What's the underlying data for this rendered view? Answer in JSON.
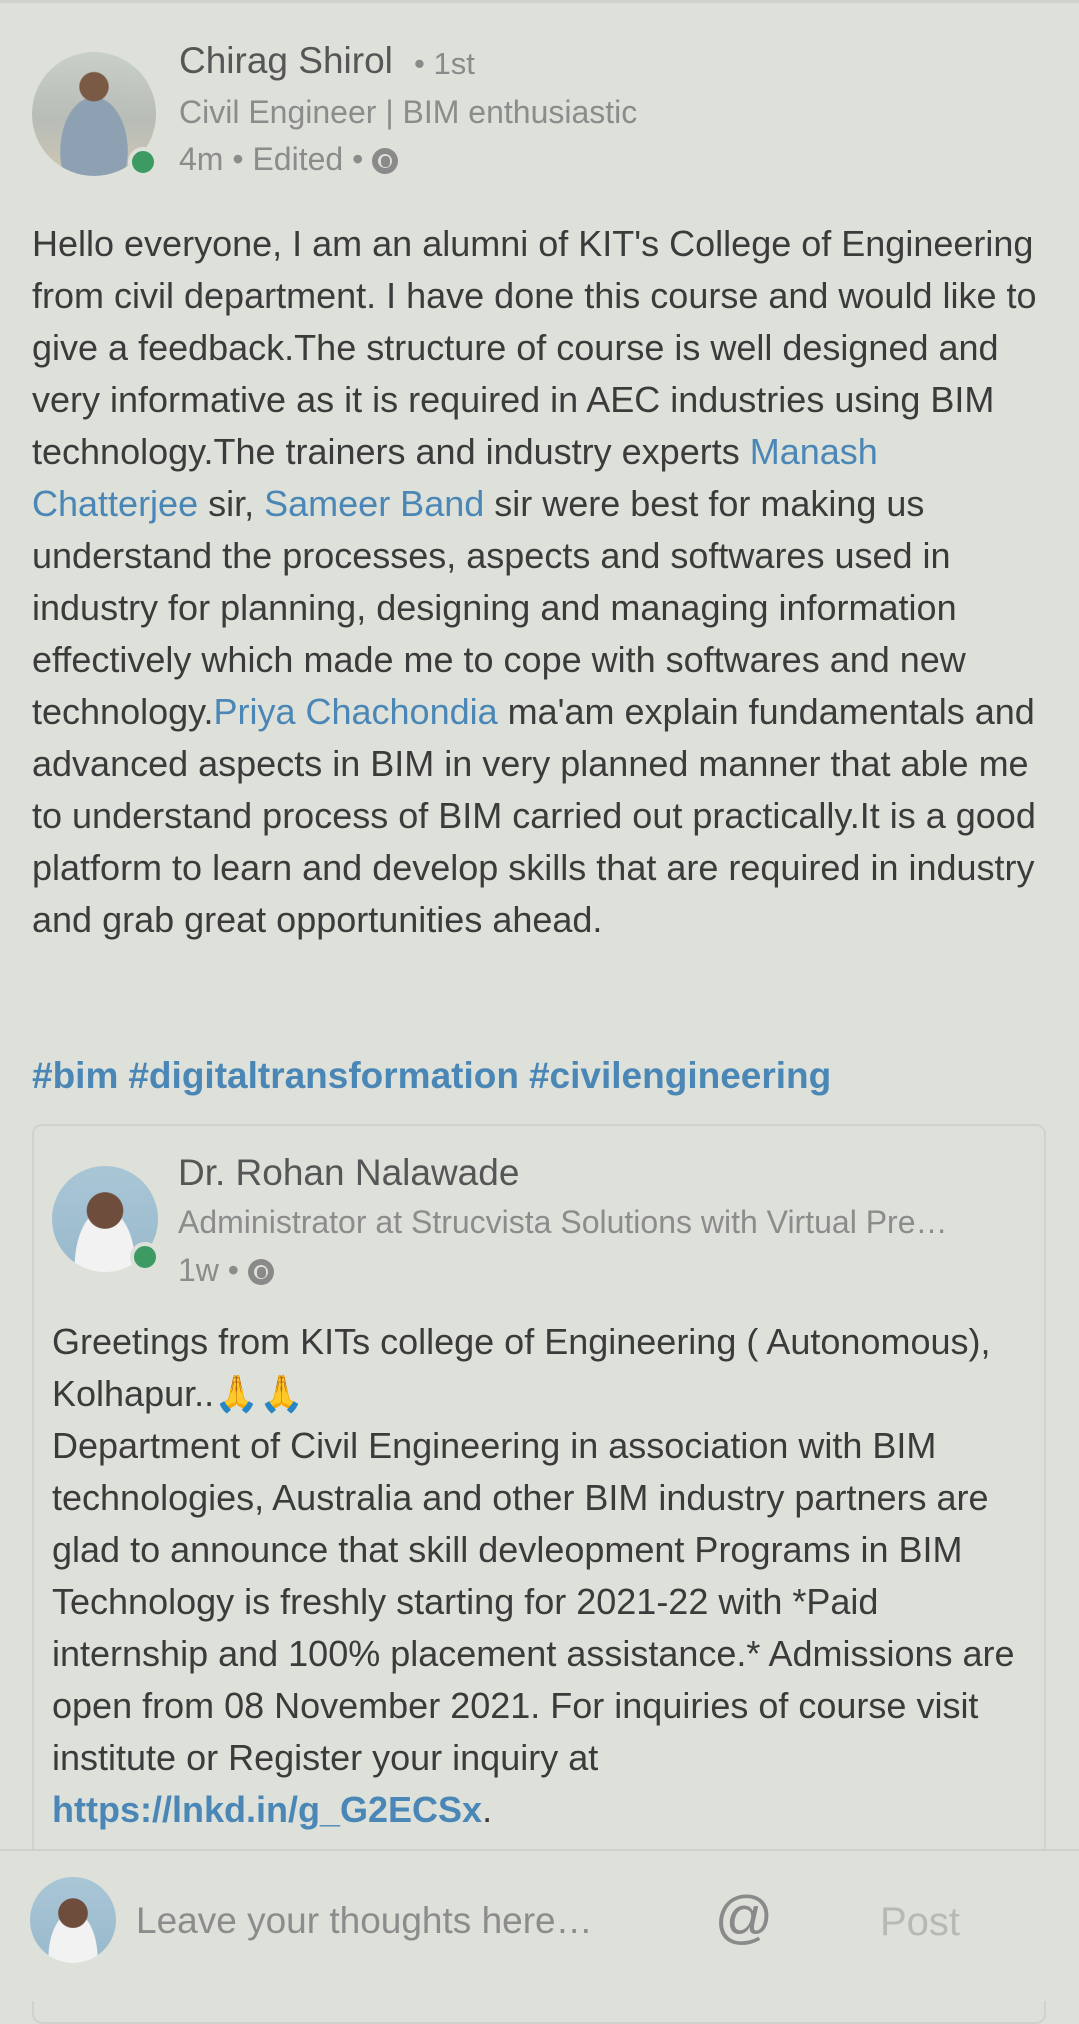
{
  "post": {
    "author": {
      "name": "Chirag Shirol",
      "degree": "• 1st",
      "headline": "Civil Engineer | BIM enthusiastic",
      "meta": "4m • Edited •"
    },
    "body": [
      {
        "text": "Hello everyone, I am an alumni of KIT's College of Engineering from civil department. I have done this course and would like to give a feedback.The structure of course is well designed and very informative as it is required in AEC industries using BIM technology.The trainers and industry experts "
      },
      {
        "mention": "Manash Chatterjee"
      },
      {
        "text": " sir, "
      },
      {
        "mention": "Sameer Band"
      },
      {
        "text": " sir   were best for making us understand the processes, aspects and softwares used in industry for planning, designing and managing information effectively which made me to cope with softwares and new technology."
      },
      {
        "mention": "Priya Chachondia"
      },
      {
        "text": " ma'am explain fundamentals and advanced aspects in BIM in very planned manner that able me to understand process of BIM carried out practically.It is a good platform to learn and develop skills that are required in industry and grab great opportunities ahead."
      }
    ],
    "hashtags": [
      "#bim",
      "#digitaltransformation",
      "#civilengineering"
    ]
  },
  "shared_post": {
    "author": {
      "name": "Dr. Rohan Nalawade",
      "headline": "Administrator at Strucvista Solutions with Virtual Pre…",
      "meta": "1w •"
    },
    "body_before_link": "Greetings from KITs college of Engineering ( Autonomous), Kolhapur..🙏🙏\nDepartment of Civil Engineering in association with BIM technologies,  Australia  and other BIM industry partners are glad to announce that skill devleopment Programs in  BIM Technology is freshly starting  for 2021-22 with *Paid internship and 100% placement assistance.* Admissions are open from 08 November 2021. For inquiries of course visit institute or  Register your inquiry at ",
    "link": "https://lnkd.in/g_G2ECSx",
    "body_after_link": "."
  },
  "comment_bar": {
    "placeholder": "Leave your thoughts here…",
    "mention_symbol": "@",
    "post_label": "Post"
  },
  "colors": {
    "background": "#dde1d9",
    "link": "#4a86b6",
    "presence": "#3c9a62"
  }
}
